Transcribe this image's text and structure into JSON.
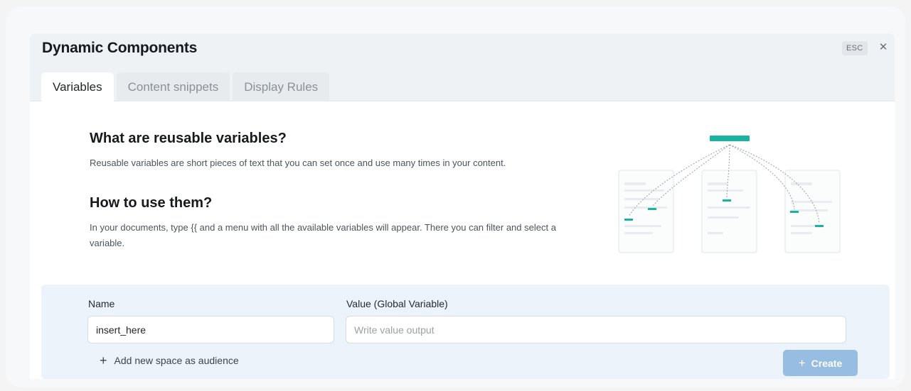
{
  "modal": {
    "title": "Dynamic Components",
    "esc_label": "ESC",
    "close_glyph": "✕"
  },
  "tabs": [
    {
      "label": "Variables",
      "active": true
    },
    {
      "label": "Content snippets",
      "active": false
    },
    {
      "label": "Display Rules",
      "active": false
    }
  ],
  "intro": {
    "heading_1": "What are reusable variables?",
    "text_1": "Reusable variables are short pieces of text that you can set once and use many times in your content.",
    "heading_2": "How to use them?",
    "text_2": "In your documents, type {{ and a menu with all the available variables will appear. There you can filter and select a variable."
  },
  "form": {
    "name_label": "Name",
    "name_value": "insert_here",
    "value_label": "Value (Global Variable)",
    "value_placeholder": "Write value output",
    "add_audience_label": "Add new space as audience",
    "create_label": "Create"
  },
  "icons": {
    "close": "close-icon",
    "add": "plus-icon",
    "create": "plus-icon"
  },
  "colors": {
    "accent": "#19b3a0",
    "primary_button": "#97bde3",
    "panel_bg": "#edf3fb",
    "header_bg": "#eef2f4"
  }
}
